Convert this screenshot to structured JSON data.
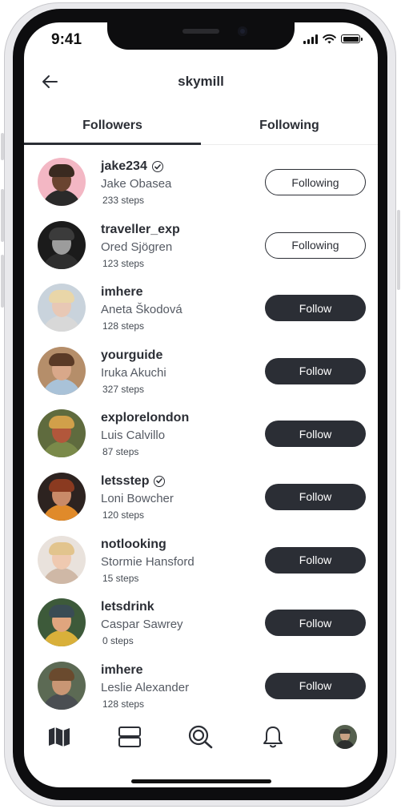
{
  "status_bar": {
    "time": "9:41"
  },
  "header": {
    "title": "skymill"
  },
  "tabs": [
    {
      "label": "Followers",
      "active": true
    },
    {
      "label": "Following",
      "active": false
    }
  ],
  "users": [
    {
      "username": "jake234",
      "verified": true,
      "name": "Jake Obasea",
      "steps": "233 steps",
      "button": "Following",
      "button_style": "outline",
      "avatar": {
        "bg": "#f3b7c4",
        "skin": "#6a4430",
        "shirt": "#2a2a2a",
        "hair": "#3a2a20"
      }
    },
    {
      "username": "traveller_exp",
      "verified": false,
      "name": "Ored Sjögren",
      "steps": "123 steps",
      "button": "Following",
      "button_style": "outline",
      "avatar": {
        "bg": "#1b1b1b",
        "skin": "#9c9c9c",
        "shirt": "#2e2e2e",
        "hair": "#3b3b3b"
      }
    },
    {
      "username": "imhere",
      "verified": false,
      "name": "Aneta Škodová",
      "steps": "128 steps",
      "button": "Follow",
      "button_style": "filled",
      "avatar": {
        "bg": "#c9d3dc",
        "skin": "#e8c8b5",
        "shirt": "#d8d8d8",
        "hair": "#e9d6a8"
      }
    },
    {
      "username": "yourguide",
      "verified": false,
      "name": "Iruka Akuchi",
      "steps": "327 steps",
      "button": "Follow",
      "button_style": "filled",
      "avatar": {
        "bg": "#b58e6a",
        "skin": "#d9a88a",
        "shirt": "#a9c2d8",
        "hair": "#5a3a26"
      }
    },
    {
      "username": "explorelondon",
      "verified": false,
      "name": "Luis Calvillo",
      "steps": "87 steps",
      "button": "Follow",
      "button_style": "filled",
      "avatar": {
        "bg": "#5f6b3e",
        "skin": "#b2573b",
        "shirt": "#7a8a4a",
        "hair": "#d1a04a"
      }
    },
    {
      "username": "letsstep",
      "verified": true,
      "name": "Loni Bowcher",
      "steps": "120 steps",
      "button": "Follow",
      "button_style": "filled",
      "avatar": {
        "bg": "#2d2320",
        "skin": "#c98a68",
        "shirt": "#e08a2a",
        "hair": "#8a3a20"
      }
    },
    {
      "username": "notlooking",
      "verified": false,
      "name": "Stormie Hansford",
      "steps": "15 steps",
      "button": "Follow",
      "button_style": "filled",
      "avatar": {
        "bg": "#e9e2dc",
        "skin": "#efc9b0",
        "shirt": "#cfb8a6",
        "hair": "#e2c48d"
      }
    },
    {
      "username": "letsdrink",
      "verified": false,
      "name": "Caspar Sawrey",
      "steps": "0 steps",
      "button": "Follow",
      "button_style": "filled",
      "avatar": {
        "bg": "#3d5a3a",
        "skin": "#e0a57e",
        "shirt": "#d9b03a",
        "hair": "#3a4c54"
      }
    },
    {
      "username": "imhere",
      "verified": false,
      "name": "Leslie Alexander",
      "steps": "128 steps",
      "button": "Follow",
      "button_style": "filled",
      "avatar": {
        "bg": "#5c6a54",
        "skin": "#c99674",
        "shirt": "#4a4e52",
        "hair": "#6a4a2e"
      }
    }
  ],
  "bottom_nav": [
    {
      "icon": "map-icon"
    },
    {
      "icon": "feed-icon"
    },
    {
      "icon": "search-icon"
    },
    {
      "icon": "bell-icon"
    },
    {
      "icon": "profile-avatar"
    }
  ]
}
